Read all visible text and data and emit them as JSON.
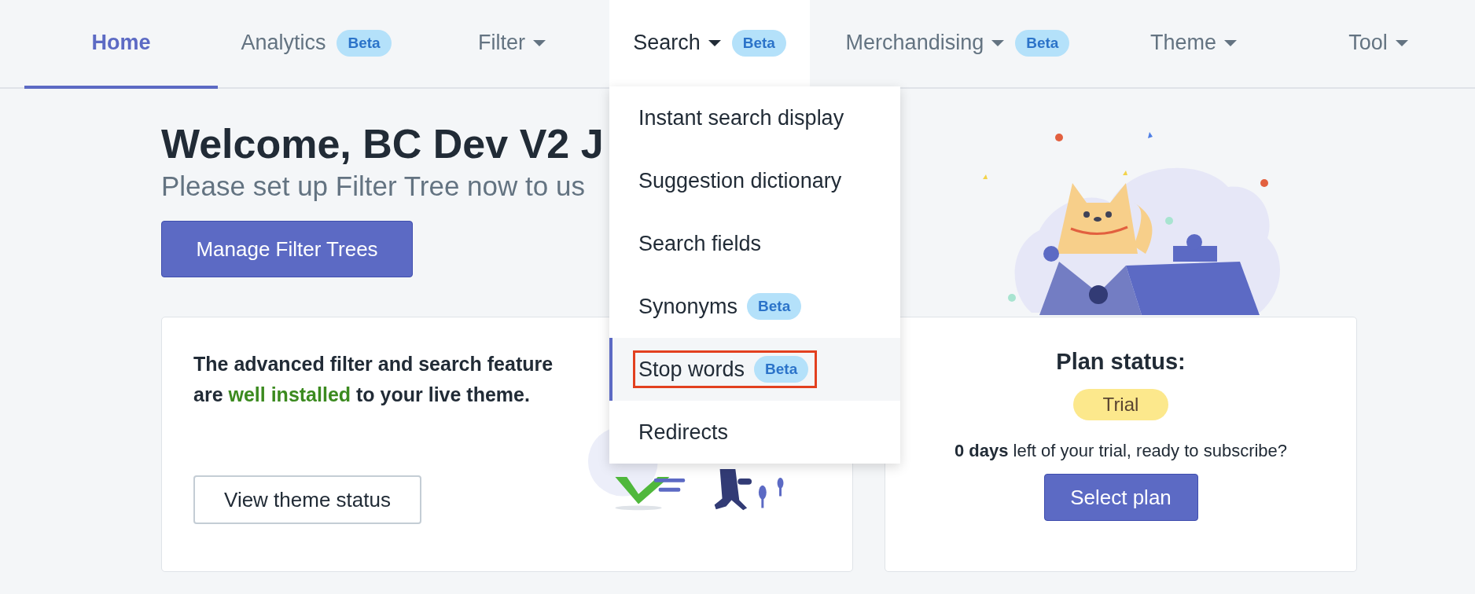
{
  "nav": {
    "tabs": [
      {
        "label": "Home",
        "selected": true,
        "expanded": false,
        "caret": false
      },
      {
        "label": "Analytics",
        "badge": "Beta",
        "selected": false,
        "expanded": false,
        "caret": false
      },
      {
        "label": "Filter",
        "selected": false,
        "expanded": false,
        "caret": true
      },
      {
        "label": "Search",
        "badge": "Beta",
        "selected": false,
        "expanded": true,
        "caret": true
      },
      {
        "label": "Merchandising",
        "badge": "Beta",
        "selected": false,
        "expanded": false,
        "caret": true
      },
      {
        "label": "Theme",
        "selected": false,
        "expanded": false,
        "caret": true
      },
      {
        "label": "Tool",
        "selected": false,
        "expanded": false,
        "caret": true
      }
    ]
  },
  "search_menu": {
    "items": [
      {
        "label": "Instant search display",
        "selected": false,
        "outlined": false
      },
      {
        "label": "Suggestion dictionary",
        "selected": false,
        "outlined": false
      },
      {
        "label": "Search fields",
        "selected": false,
        "outlined": false
      },
      {
        "label": "Synonyms",
        "badge": "Beta",
        "selected": false,
        "outlined": false
      },
      {
        "label": "Stop words",
        "badge": "Beta",
        "selected": true,
        "outlined": true
      },
      {
        "label": "Redirects",
        "selected": false,
        "outlined": false
      }
    ]
  },
  "welcome": {
    "title": "Welcome, BC Dev V2 J",
    "subtitle": "Please set up Filter Tree now to us",
    "button": "Manage Filter Trees"
  },
  "theme_card": {
    "lines": [
      [
        {
          "kind": "plain",
          "text": "The advanced filter and search feature"
        }
      ],
      [
        {
          "kind": "plain",
          "text": "are "
        },
        {
          "kind": "success",
          "text": "well installed"
        },
        {
          "kind": "plain",
          "text": " to your live theme."
        }
      ]
    ],
    "button": "View theme status"
  },
  "plan_card": {
    "title": "Plan status:",
    "status": "Trial",
    "note": "**0 days** left of your trial, ready to subscribe?",
    "button": "Select plan"
  }
}
